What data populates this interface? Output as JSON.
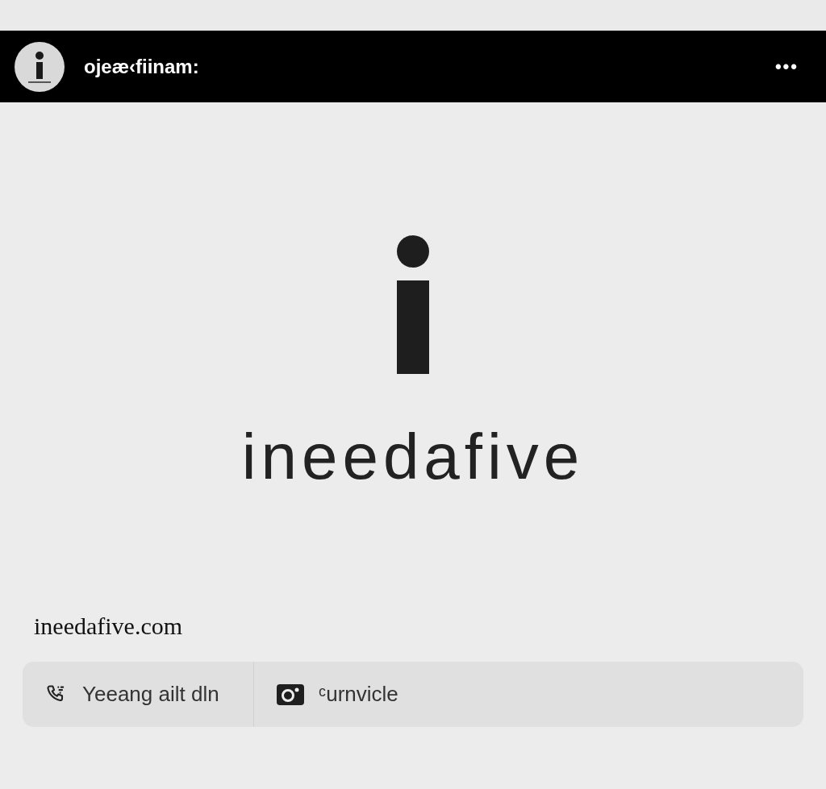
{
  "header": {
    "title": "ojeæ‹fiinam:",
    "menu": "•••"
  },
  "logo": {
    "wordmark": "ineedafive"
  },
  "domain": "ineedafive.com",
  "contact_bar": [
    {
      "kind": "phone",
      "label": "Yeeang ailt dln"
    },
    {
      "kind": "camera",
      "label": "ᶜurnvicle"
    }
  ]
}
